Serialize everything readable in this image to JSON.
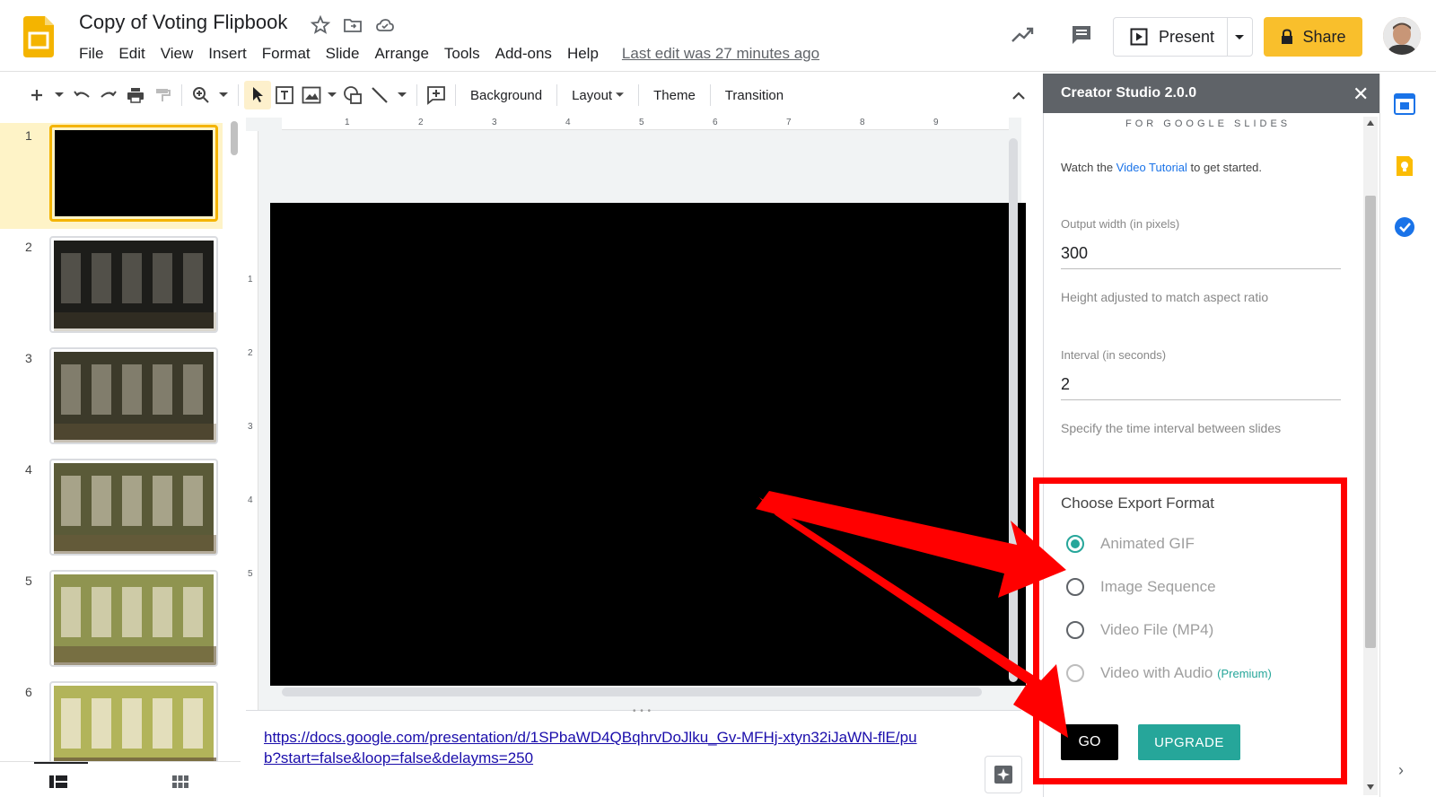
{
  "header": {
    "title": "Copy of Voting Flipbook",
    "menu": [
      "File",
      "Edit",
      "View",
      "Insert",
      "Format",
      "Slide",
      "Arrange",
      "Tools",
      "Add-ons",
      "Help"
    ],
    "last_edit": "Last edit was 27 minutes ago",
    "present_label": "Present",
    "share_label": "Share"
  },
  "toolbar": {
    "background_label": "Background",
    "layout_label": "Layout",
    "theme_label": "Theme",
    "transition_label": "Transition"
  },
  "filmstrip": {
    "slides": [
      {
        "number": "1",
        "shade": "#000000"
      },
      {
        "number": "2",
        "shade": "#1d1d1a"
      },
      {
        "number": "3",
        "shade": "#3c3a2a"
      },
      {
        "number": "4",
        "shade": "#5a5a38"
      },
      {
        "number": "5",
        "shade": "#8f9450"
      },
      {
        "number": "6",
        "shade": "#b2b45a"
      }
    ]
  },
  "ruler": {
    "top_numbers": [
      "1",
      "2",
      "3",
      "4",
      "5",
      "6",
      "7",
      "8",
      "9"
    ],
    "left_numbers": [
      "1",
      "2",
      "3",
      "4",
      "5"
    ]
  },
  "notes": {
    "link": "https://docs.google.com/presentation/d/1SPbaWD4QBqhrvDoJlku_Gv-MFHj-xtyn32iJaWN-flE/pub?start=false&loop=false&delayms=250"
  },
  "panel": {
    "title": "Creator Studio 2.0.0",
    "subtitle": "FOR GOOGLE SLIDES",
    "watch_prefix": "Watch the ",
    "watch_link": "Video Tutorial",
    "watch_suffix": " to get started.",
    "output_width_label": "Output width (in pixels)",
    "output_width_value": "300",
    "output_width_hint": "Height adjusted to match aspect ratio",
    "interval_label": "Interval (in seconds)",
    "interval_value": "2",
    "interval_hint": "Specify the time interval between slides",
    "format_label": "Choose Export Format",
    "formats": [
      {
        "label": "Animated GIF",
        "checked": true
      },
      {
        "label": "Image Sequence",
        "checked": false
      },
      {
        "label": "Video File (MP4)",
        "checked": false
      },
      {
        "label": "Video with Audio",
        "checked": false
      }
    ],
    "premium_label": "(Premium)",
    "go_label": "GO",
    "upgrade_label": "UPGRADE"
  },
  "colors": {
    "share_yellow": "#f9bf2c",
    "accent_teal": "#26a69a",
    "highlight_red": "#ff0000",
    "selected_slide_bg": "#fef3c7"
  },
  "icons": {
    "logo": "slides-logo-icon",
    "star": "star-icon",
    "folder": "move-folder-icon",
    "cloud": "cloud-status-icon",
    "trend": "activity-trend-icon",
    "comment": "comment-icon",
    "present": "present-play-icon",
    "lock": "lock-icon",
    "close": "close-icon",
    "calendar": "calendar-icon",
    "keep": "keep-icon",
    "tasks": "tasks-icon"
  }
}
